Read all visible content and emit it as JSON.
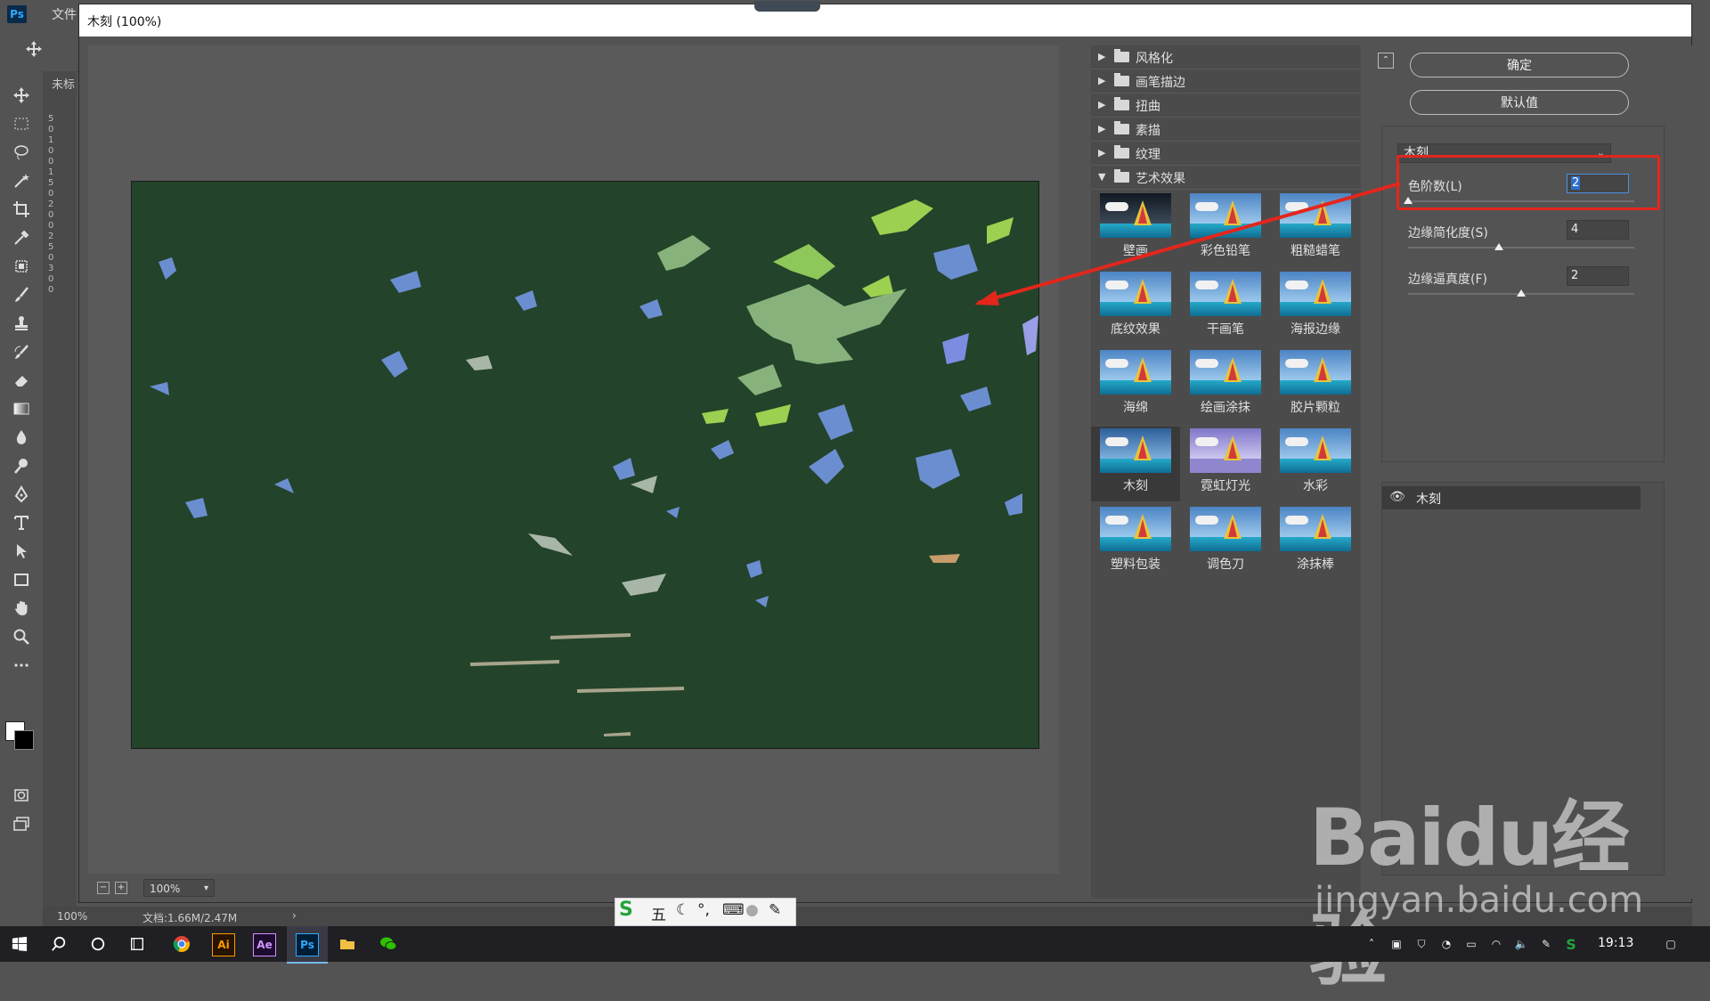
{
  "app": {
    "logo": "Ps",
    "menu_file": "文件",
    "doc_tab": "未标"
  },
  "ruler_ticks": [
    "5",
    "0",
    "1",
    "0",
    "0",
    "1",
    "5",
    "0",
    "2",
    "0",
    "0",
    "2",
    "5",
    "0",
    "3",
    "0",
    "0"
  ],
  "dialog": {
    "title": "木刻 (100%)"
  },
  "zoom": {
    "value": "100%"
  },
  "categories": [
    {
      "label": "风格化",
      "expanded": false
    },
    {
      "label": "画笔描边",
      "expanded": false
    },
    {
      "label": "扭曲",
      "expanded": false
    },
    {
      "label": "素描",
      "expanded": false
    },
    {
      "label": "纹理",
      "expanded": false
    },
    {
      "label": "艺术效果",
      "expanded": true
    }
  ],
  "thumbnails": [
    {
      "label": "壁画"
    },
    {
      "label": "彩色铅笔"
    },
    {
      "label": "粗糙蜡笔"
    },
    {
      "label": "底纹效果"
    },
    {
      "label": "干画笔"
    },
    {
      "label": "海报边缘"
    },
    {
      "label": "海绵"
    },
    {
      "label": "绘画涂抹"
    },
    {
      "label": "胶片颗粒"
    },
    {
      "label": "木刻",
      "selected": true
    },
    {
      "label": "霓虹灯光"
    },
    {
      "label": "水彩"
    },
    {
      "label": "塑料包装"
    },
    {
      "label": "调色刀"
    },
    {
      "label": "涂抹棒"
    }
  ],
  "buttons": {
    "ok": "确定",
    "default": "默认值"
  },
  "filter_select": {
    "value": "木刻"
  },
  "params": [
    {
      "label": "色阶数(L)",
      "value": "2",
      "fraction": 0.0
    },
    {
      "label": "边缘简化度(S)",
      "value": "4",
      "fraction": 0.4
    },
    {
      "label": "边缘逼真度(F)",
      "value": "2",
      "fraction": 0.5
    }
  ],
  "layers": {
    "name": "木刻"
  },
  "status": {
    "zoom": "100%",
    "doc": "文档:1.66M/2.47M"
  },
  "taskbar": {
    "time": "19:13"
  },
  "ime": {
    "label": "五"
  },
  "watermark": {
    "logo": "Baidu经验",
    "url": "jingyan.baidu.com"
  },
  "colors": {
    "canvas": "#23432a",
    "accent": "#e3261c",
    "selection": "#2d6fd0"
  }
}
